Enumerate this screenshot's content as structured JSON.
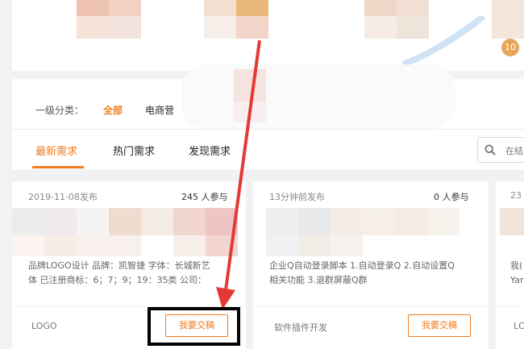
{
  "badge": "10",
  "filter": {
    "label": "一级分类：",
    "options": [
      "全部",
      "电商营"
    ]
  },
  "tabs": [
    "最新需求",
    "热门需求",
    "发现需求"
  ],
  "search": {
    "placeholder": "在结"
  },
  "cards": [
    {
      "date": "2019-11-08发布",
      "count": "245 人参与",
      "desc_line1": "品牌LOGO设计 品牌：凯智捷 字体：长城新艺",
      "desc_line2": "体 已注册商标：6；7；9；19：35类 公司：",
      "tag": "LOGO",
      "button": "我要交稿"
    },
    {
      "date": "13分钟前发布",
      "count": "0 人参与",
      "desc_line1": "企业Q自动登录脚本 1.自动登录Q 2.自动设置Q",
      "desc_line2": "相关功能 3.退群屏蔽Q群",
      "tag": "软件插件开发",
      "button": "我要交稿"
    },
    {
      "date": "23",
      "desc_line1": "我(",
      "desc_line2": "Yar",
      "tag": "LC"
    }
  ],
  "colors": {
    "accent": "#f07c1c",
    "annotation_arrow": "#e53935",
    "highlight_border": "#000000"
  }
}
